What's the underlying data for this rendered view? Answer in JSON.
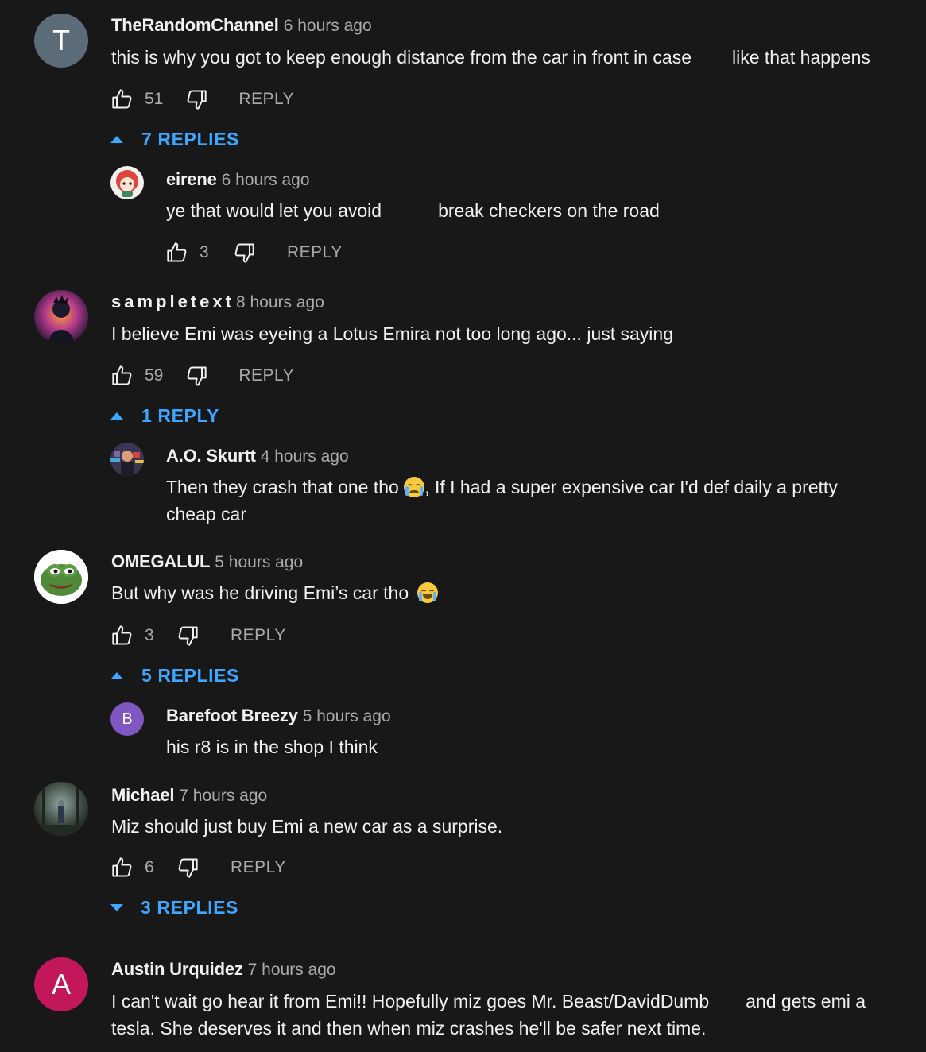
{
  "reply_label": "REPLY",
  "comments": [
    {
      "author": "TheRandomChannel",
      "time": "6 hours ago",
      "avatar_letter": "T",
      "text_a": "this is why you got to keep enough distance from the car in front in case",
      "text_b": "like that happens",
      "likes": "51",
      "replies_toggle": "7 REPLIES",
      "reply": {
        "author": "eirene",
        "time": "6 hours ago",
        "text_a": "ye that would let you avoid",
        "text_b": "break checkers on the road",
        "likes": "3"
      }
    },
    {
      "author": "sampletext",
      "time": "8 hours ago",
      "text": "I believe Emi was eyeing a Lotus Emira not too long ago... just saying",
      "likes": "59",
      "replies_toggle": "1 REPLY",
      "reply": {
        "author": "A.O. Skurtt",
        "time": "4 hours ago",
        "line1_a": "Then they crash that one tho",
        "line1_b": ", If I had a super expensive car I'd def daily a pretty",
        "line2": "cheap car"
      }
    },
    {
      "author": "OMEGALUL",
      "time": "5 hours ago",
      "text": "But why was he driving Emi’s car tho",
      "likes": "3",
      "replies_toggle": "5 REPLIES",
      "reply": {
        "author": "Barefoot Breezy",
        "time": "5 hours ago",
        "avatar_letter": "B",
        "text": "his r8 is in the shop I think"
      }
    },
    {
      "author": "Michael",
      "time": "7 hours ago",
      "text": "Miz should just buy Emi a new car as a surprise.",
      "likes": "6",
      "replies_toggle": "3 REPLIES"
    },
    {
      "author": "Austin Urquidez",
      "time": "7 hours ago",
      "avatar_letter": "A",
      "line1_a": "I can't wait go hear it from Emi!! Hopefully miz goes Mr. Beast/DavidDumb",
      "line1_b": "and gets emi a",
      "line2": "tesla. She deserves it and then when miz crashes he'll be safer next time."
    }
  ],
  "colors": {
    "background": "#181818",
    "link_blue": "#3ea6ff",
    "secondary_text": "#aaaaaa",
    "avatar_T": "#5c6b78",
    "avatar_B": "#7e57c2",
    "avatar_A": "#c2185b"
  }
}
